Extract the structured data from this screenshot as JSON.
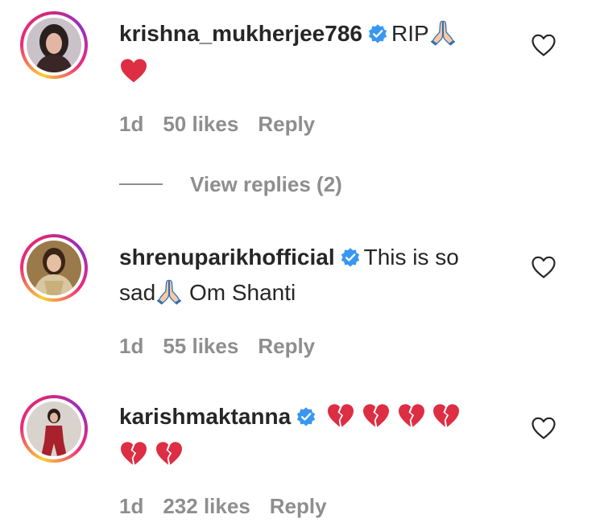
{
  "comments": [
    {
      "username": "krishna_mukherjee786",
      "text": "RIP",
      "emojis_after": [
        "pray",
        "heart"
      ],
      "age": "1d",
      "likes": "50 likes",
      "reply_label": "Reply",
      "verified_icon": "verified-badge-icon",
      "like_icon": "heart-outline-icon",
      "view_replies": "View replies (2)"
    },
    {
      "username": "shrenuparikhofficial",
      "text_part1": "This is so",
      "text_part2": "sad",
      "text_part3": "Om Shanti",
      "age": "1d",
      "likes": "55 likes",
      "reply_label": "Reply",
      "verified_icon": "verified-badge-icon",
      "like_icon": "heart-outline-icon"
    },
    {
      "username": "karishmaktanna",
      "emojis": [
        "broken-heart",
        "broken-heart",
        "broken-heart",
        "broken-heart",
        "broken-heart",
        "broken-heart"
      ],
      "age": "1d",
      "likes": "232 likes",
      "reply_label": "Reply",
      "verified_icon": "verified-badge-icon",
      "like_icon": "heart-outline-icon"
    }
  ],
  "colors": {
    "text": "#262626",
    "muted": "#8e8e8e",
    "verified": "#3897f0",
    "heart_red": "#dd2e44",
    "story_ring": [
      "#f9ce34",
      "#ee2a7b",
      "#962fbf"
    ]
  }
}
